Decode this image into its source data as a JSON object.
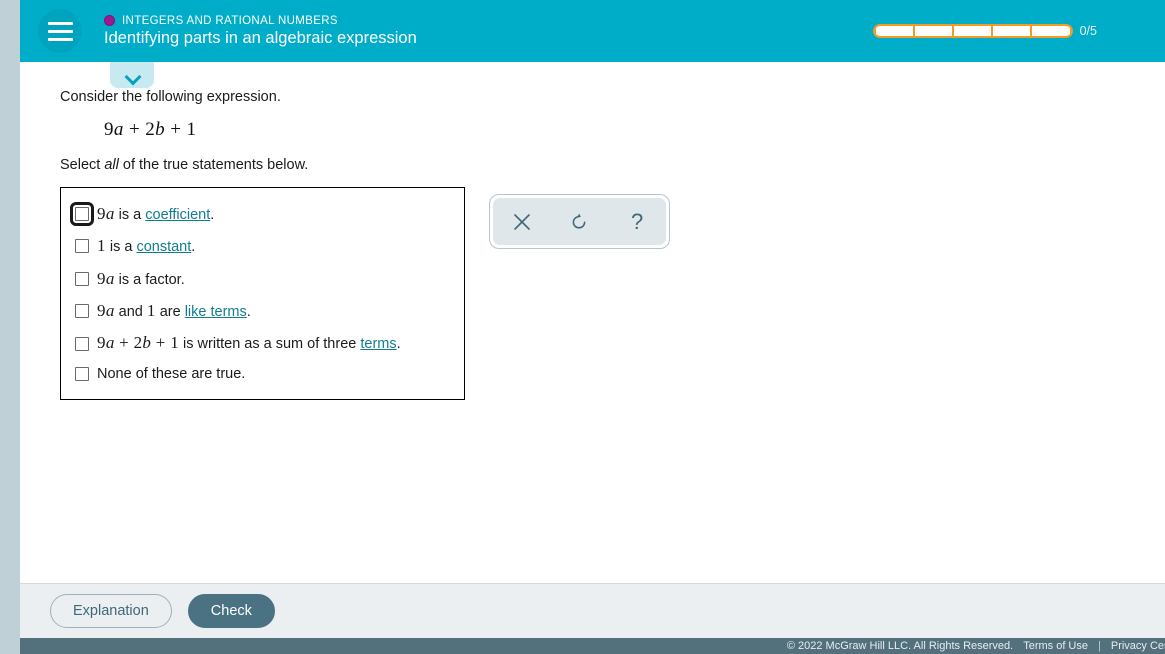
{
  "header": {
    "menu_icon": "hamburger-menu-icon",
    "topic_label": "INTEGERS AND RATIONAL NUMBERS",
    "title": "Identifying parts in an algebraic expression",
    "progress": {
      "count_label": "0/5",
      "total_segments": 5,
      "completed": 0,
      "border_color": "#f59a27",
      "segment_color": "#ffffff"
    },
    "background_color": "#00adc9"
  },
  "collapse_tab": {
    "icon": "chevron-down-icon"
  },
  "question": {
    "prompt": "Consider the following expression.",
    "expression": {
      "coeff1": "9",
      "var1": "a",
      "plus1": " + ",
      "coeff2": "2",
      "var2": "b",
      "plus2": " + ",
      "constant": "1",
      "full": "9a + 2b + 1"
    },
    "instruction_before": "Select ",
    "instruction_emphasis": "all",
    "instruction_after": " of the true statements below."
  },
  "options": [
    {
      "id": "opt-coefficient",
      "checked": false,
      "focused": true,
      "text_parts": [
        {
          "type": "math",
          "value": "9a"
        },
        {
          "type": "plain",
          "value": " is a "
        },
        {
          "type": "link",
          "value": "coefficient"
        },
        {
          "type": "plain",
          "value": "."
        }
      ]
    },
    {
      "id": "opt-constant",
      "checked": false,
      "focused": false,
      "text_parts": [
        {
          "type": "math",
          "value": "1"
        },
        {
          "type": "plain",
          "value": " is a "
        },
        {
          "type": "link",
          "value": "constant"
        },
        {
          "type": "plain",
          "value": "."
        }
      ]
    },
    {
      "id": "opt-factor",
      "checked": false,
      "focused": false,
      "text_parts": [
        {
          "type": "math",
          "value": "9a"
        },
        {
          "type": "plain",
          "value": " is a factor."
        }
      ]
    },
    {
      "id": "opt-like-terms",
      "checked": false,
      "focused": false,
      "text_parts": [
        {
          "type": "math",
          "value": "9a"
        },
        {
          "type": "plain",
          "value": " and "
        },
        {
          "type": "math",
          "value": "1"
        },
        {
          "type": "plain",
          "value": " are "
        },
        {
          "type": "link",
          "value": "like terms"
        },
        {
          "type": "plain",
          "value": "."
        }
      ]
    },
    {
      "id": "opt-sum-of-three-terms",
      "checked": false,
      "focused": false,
      "text_parts": [
        {
          "type": "math",
          "value": "9a + 2b + 1"
        },
        {
          "type": "plain",
          "value": " is written as a sum of three "
        },
        {
          "type": "link",
          "value": "terms"
        },
        {
          "type": "plain",
          "value": "."
        }
      ]
    },
    {
      "id": "opt-none",
      "checked": false,
      "focused": false,
      "text_parts": [
        {
          "type": "plain",
          "value": "None of these are true."
        }
      ]
    }
  ],
  "tool_palette": {
    "buttons": [
      {
        "id": "clear",
        "icon": "close-x-icon",
        "glyph": ""
      },
      {
        "id": "undo",
        "icon": "undo-arrow-icon",
        "glyph": ""
      },
      {
        "id": "help",
        "icon": "question-mark-icon",
        "glyph": "?"
      }
    ]
  },
  "actions": {
    "explanation_label": "Explanation",
    "check_label": "Check"
  },
  "footer": {
    "copyright": "© 2022 McGraw Hill LLC. All Rights Reserved.",
    "terms_label": "Terms of Use",
    "separator": "|",
    "privacy_label": "Privacy Center",
    "background_color": "#52717d"
  }
}
